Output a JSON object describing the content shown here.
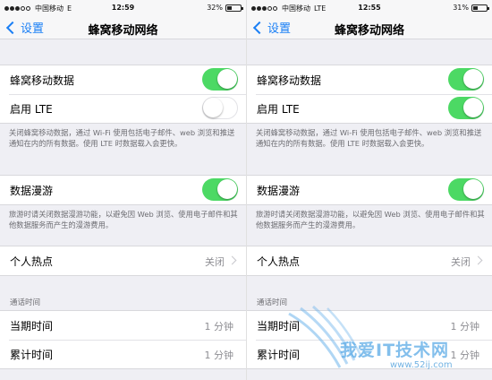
{
  "left": {
    "status": {
      "carrier": "中国移动",
      "network": "E",
      "time": "12:59",
      "battery": "32%",
      "battery_level": 0.32,
      "signal_bars": 3
    },
    "nav": {
      "back_label": "设置",
      "title": "蜂窝移动网络"
    },
    "cellular_data": {
      "label": "蜂窝移动数据",
      "on": true
    },
    "lte": {
      "label": "启用 LTE",
      "on": false
    },
    "note1": "关闭蜂窝移动数据，通过 Wi-Fi 使用包括电子邮件、web 浏览和推送通知在内的所有数据。使用 LTE 时数据载入会更快。",
    "roaming": {
      "label": "数据漫游",
      "on": true
    },
    "note2": "旅游时请关闭数据漫游功能，以避免因 Web 浏览、使用电子邮件和其他数据服务而产生的漫游费用。",
    "hotspot": {
      "label": "个人热点",
      "value": "关闭"
    },
    "call_time_header": "通话时间",
    "current_period": {
      "label": "当期时间",
      "value": "1 分钟"
    },
    "lifetime": {
      "label": "累计时间",
      "value": "1 分钟"
    }
  },
  "right": {
    "status": {
      "carrier": "中国移动",
      "network": "LTE",
      "time": "12:55",
      "battery": "31%",
      "battery_level": 0.31,
      "signal_bars": 3
    },
    "nav": {
      "back_label": "设置",
      "title": "蜂窝移动网络"
    },
    "cellular_data": {
      "label": "蜂窝移动数据",
      "on": true
    },
    "lte": {
      "label": "启用 LTE",
      "on": true
    },
    "note1": "关闭蜂窝移动数据，通过 Wi-Fi 使用包括电子邮件、web 浏览和推送通知在内的所有数据。使用 LTE 时数据载入会更快。",
    "roaming": {
      "label": "数据漫游",
      "on": true
    },
    "note2": "旅游时请关闭数据漫游功能，以避免因 Web 浏览、使用电子邮件和其他数据服务而产生的漫游费用。",
    "hotspot": {
      "label": "个人热点",
      "value": "关闭"
    },
    "call_time_header": "通话时间",
    "current_period": {
      "label": "当期时间",
      "value": "1 分钟"
    },
    "lifetime": {
      "label": "累计时间",
      "value": "1 分钟"
    }
  },
  "watermark": {
    "text": "我爱IT技术网",
    "url": "www.52ij.com"
  },
  "colors": {
    "toggle_on": "#4cd964",
    "ios_blue": "#1a7ff5",
    "group_bg": "#efeff4"
  }
}
